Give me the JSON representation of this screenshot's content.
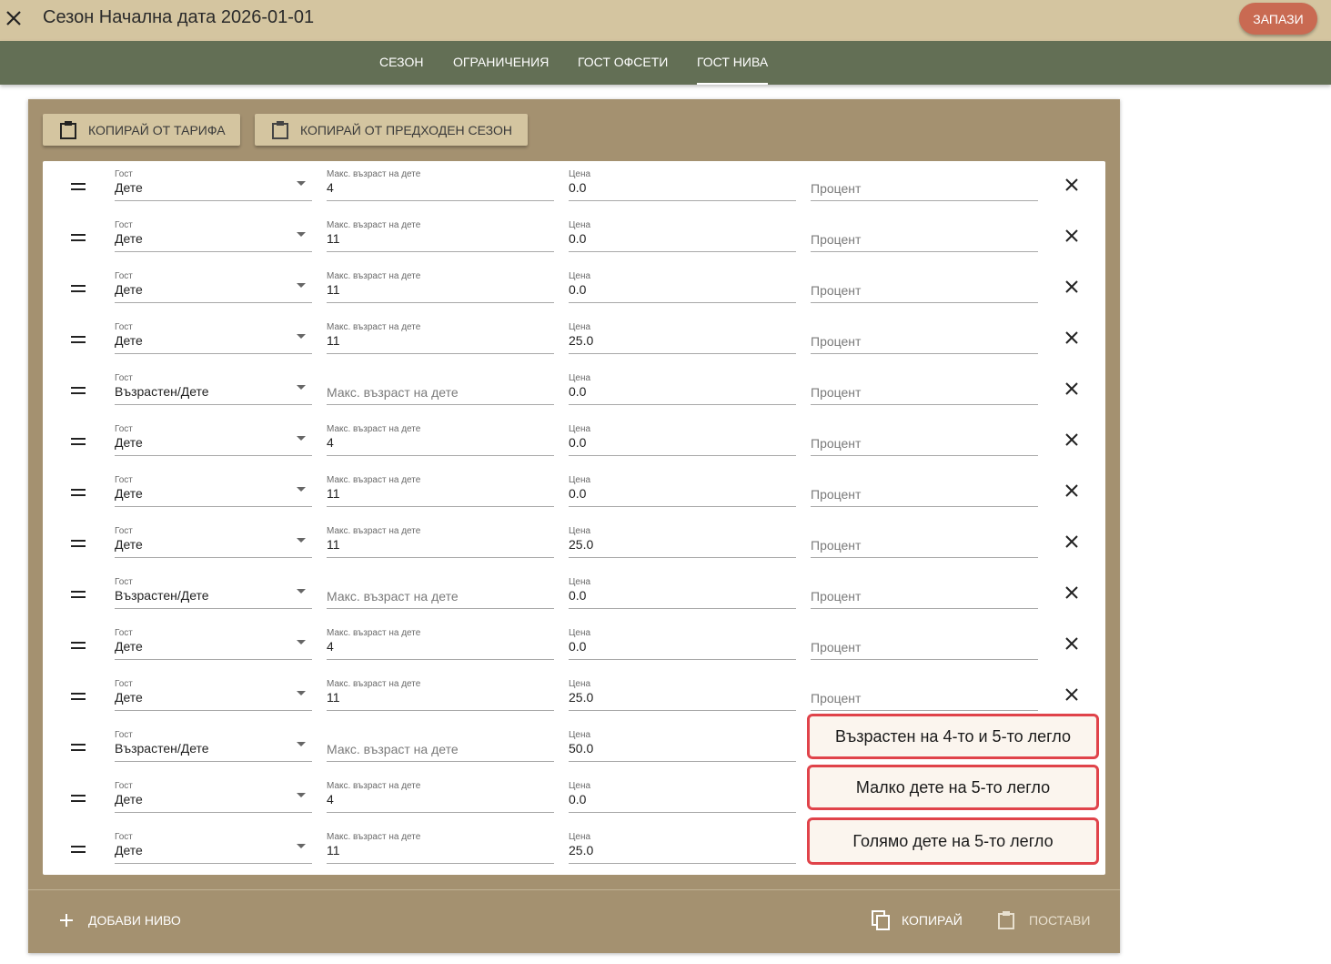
{
  "header": {
    "title": "Сезон Начална дата 2026-01-01",
    "save_label": "ЗАПАЗИ"
  },
  "tabs": [
    {
      "label": "СЕЗОН",
      "active": false
    },
    {
      "label": "ОГРАНИЧЕНИЯ",
      "active": false
    },
    {
      "label": "ГОСТ ОФСЕТИ",
      "active": false
    },
    {
      "label": "ГОСТ НИВА",
      "active": true
    }
  ],
  "toolbar": {
    "copy_from_tariff": "КОПИРАЙ ОТ ТАРИФА",
    "copy_from_previous": "КОПИРАЙ ОТ ПРЕДХОДЕН СЕЗОН"
  },
  "field_labels": {
    "guest": "Гост",
    "max_age": "Макс. възраст на дете",
    "price": "Цена",
    "percent": "Процент"
  },
  "rows": [
    {
      "guest": "Дете",
      "max_age": "4",
      "price": "0.0"
    },
    {
      "guest": "Дете",
      "max_age": "11",
      "price": "0.0"
    },
    {
      "guest": "Дете",
      "max_age": "11",
      "price": "0.0"
    },
    {
      "guest": "Дете",
      "max_age": "11",
      "price": "25.0"
    },
    {
      "guest": "Възрастен/Дете",
      "max_age": "",
      "price": "0.0"
    },
    {
      "guest": "Дете",
      "max_age": "4",
      "price": "0.0"
    },
    {
      "guest": "Дете",
      "max_age": "11",
      "price": "0.0"
    },
    {
      "guest": "Дете",
      "max_age": "11",
      "price": "25.0"
    },
    {
      "guest": "Възрастен/Дете",
      "max_age": "",
      "price": "0.0"
    },
    {
      "guest": "Дете",
      "max_age": "4",
      "price": "0.0"
    },
    {
      "guest": "Дете",
      "max_age": "11",
      "price": "25.0"
    },
    {
      "guest": "Възрастен/Дете",
      "max_age": "",
      "price": "50.0"
    },
    {
      "guest": "Дете",
      "max_age": "4",
      "price": "0.0"
    },
    {
      "guest": "Дете",
      "max_age": "11",
      "price": "25.0"
    }
  ],
  "callouts": [
    "Възрастен на 4-то и 5-то легло",
    "Малко дете на 5-то легло",
    "Голямо дете на 5-то легло"
  ],
  "footer": {
    "add_level": "ДОБАВИ НИВО",
    "copy": "КОПИРАЙ",
    "paste": "ПОСТАВИ"
  },
  "colors": {
    "header_bg": "#d4c5a0",
    "tabbar_bg": "#636f55",
    "panel_bg": "#a49170",
    "save_button": "#c96a52",
    "callout_border": "#e0434a"
  }
}
